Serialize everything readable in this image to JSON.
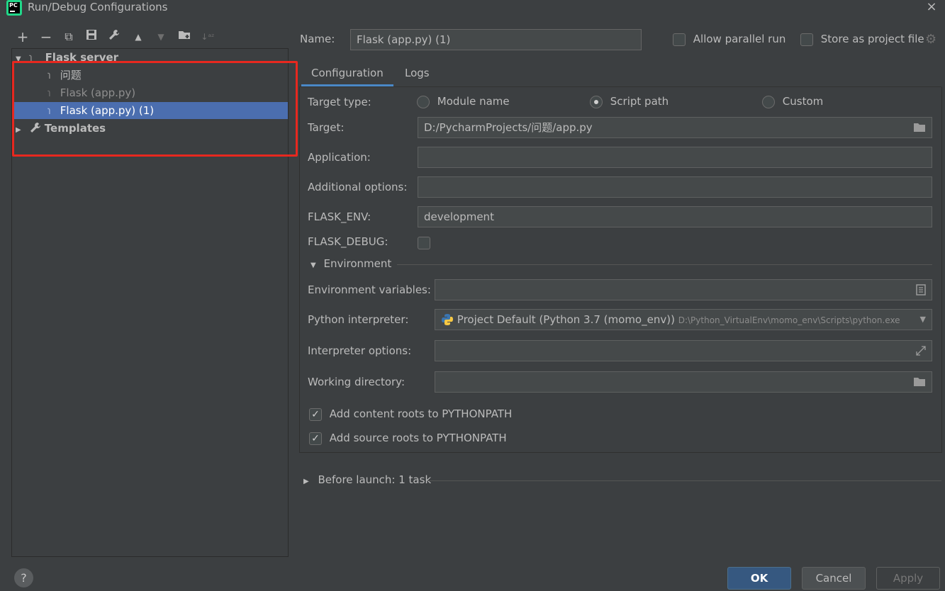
{
  "window": {
    "title": "Run/Debug Configurations",
    "close": "×",
    "app_icon_text": "PC"
  },
  "toolbar": {
    "add": "+",
    "remove": "−",
    "copy": "⧉",
    "save": "💾",
    "edit": "🔧",
    "up": "▲",
    "down": "▼",
    "folder": "📁",
    "sort": "↓ᵃᶻ"
  },
  "tree": {
    "group": "Flask server",
    "items": [
      {
        "label": "问题"
      },
      {
        "label": "Flask (app.py)"
      },
      {
        "label": "Flask (app.py) (1)"
      }
    ],
    "templates": "Templates"
  },
  "header": {
    "name_label": "Name:",
    "name_value": "Flask (app.py) (1)",
    "allow_parallel": "Allow parallel run",
    "store_as_project": "Store as project file"
  },
  "tabs": [
    {
      "label": "Configuration"
    },
    {
      "label": "Logs"
    }
  ],
  "config": {
    "target_type_label": "Target type:",
    "target_types": [
      {
        "label": "Module name",
        "selected": false
      },
      {
        "label": "Script path",
        "selected": true
      },
      {
        "label": "Custom",
        "selected": false
      }
    ],
    "target_label": "Target:",
    "target_value": "D:/PycharmProjects/问题/app.py",
    "application_label": "Application:",
    "application_value": "",
    "additional_label": "Additional options:",
    "additional_value": "",
    "flask_env_label": "FLASK_ENV:",
    "flask_env_value": "development",
    "flask_debug_label": "FLASK_DEBUG:",
    "environment_section": "Environment",
    "env_vars_label": "Environment variables:",
    "env_vars_value": "",
    "interpreter_label": "Python interpreter:",
    "interpreter_value": "Project Default (Python 3.7 (momo_env))",
    "interpreter_path": "D:\\Python_VirtualEnv\\momo_env\\Scripts\\python.exe",
    "interp_options_label": "Interpreter options:",
    "interp_options_value": "",
    "working_dir_label": "Working directory:",
    "working_dir_value": "",
    "add_content_roots": "Add content roots to PYTHONPATH",
    "add_source_roots": "Add source roots to PYTHONPATH"
  },
  "before_launch": "Before launch: 1 task",
  "buttons": {
    "ok": "OK",
    "cancel": "Cancel",
    "apply": "Apply",
    "help": "?"
  },
  "colors": {
    "background": "#3c3f41",
    "selection": "#4b6eaf",
    "accent_tab": "#4a88c7",
    "highlight_box": "#e7281f",
    "ok_button": "#365880"
  }
}
